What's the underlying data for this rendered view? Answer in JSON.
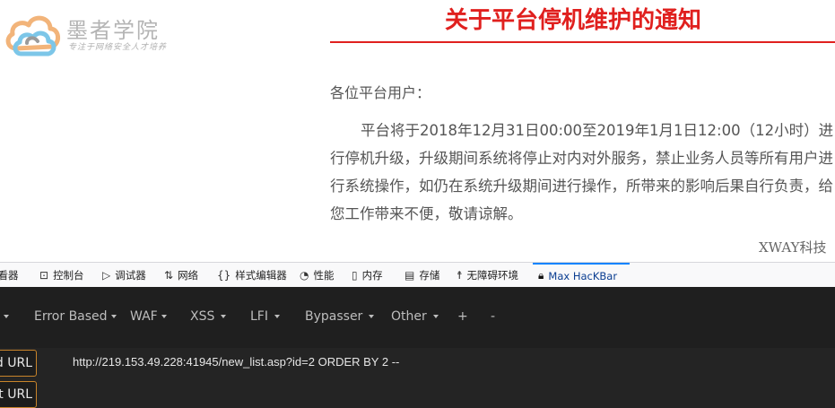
{
  "logo": {
    "title": "墨者学院",
    "subtitle": "专注于网络安全人才培养"
  },
  "notice": {
    "title": "关于平台停机维护的通知",
    "greeting": "各位平台用户：",
    "body": "平台将于2018年12月31日00:00至2019年1月1日12:00（12小时）进行停机升级，升级期间系统将停止对内对外服务，禁止业务人员等所有用户进行系统操作，如仍在系统升级期间进行操作，所带来的影响后果自行负责，给您工作带来不便，敬请谅解。",
    "signature": "XWAY科技"
  },
  "devtools": {
    "tabs": [
      {
        "label": "查看器",
        "icon": "inspector-icon"
      },
      {
        "label": "控制台",
        "icon": "console-icon"
      },
      {
        "label": "调试器",
        "icon": "debugger-icon"
      },
      {
        "label": "网络",
        "icon": "network-icon"
      },
      {
        "label": "样式编辑器",
        "icon": "style-editor-icon"
      },
      {
        "label": "性能",
        "icon": "performance-icon"
      },
      {
        "label": "内存",
        "icon": "memory-icon"
      },
      {
        "label": "存储",
        "icon": "storage-icon"
      },
      {
        "label": "无障碍环境",
        "icon": "accessibility-icon"
      },
      {
        "label": "Max HacKBar",
        "icon": "lock-icon",
        "active": true
      }
    ],
    "active_color": "#0a84ff"
  },
  "hackbar": {
    "menu": [
      {
        "label": "Error Based",
        "dropdown": true
      },
      {
        "label": "WAF",
        "dropdown": true
      },
      {
        "label": "XSS",
        "dropdown": true
      },
      {
        "label": "LFI",
        "dropdown": true
      },
      {
        "label": "Bypasser",
        "dropdown": true
      },
      {
        "label": "Other",
        "dropdown": true
      },
      {
        "label": "+",
        "dropdown": false
      },
      {
        "label": "-",
        "dropdown": false
      }
    ],
    "buttons": {
      "load_url": "ad URL",
      "split_url": "it URL"
    },
    "url_value": "http://219.153.49.228:41945/new_list.asp?id=2 ORDER BY 2 --",
    "button_border_color": "#c8842a"
  }
}
